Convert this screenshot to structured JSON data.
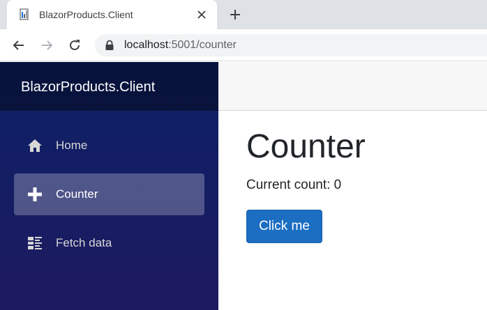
{
  "browser": {
    "tab": {
      "title": "BlazorProducts.Client"
    },
    "address": {
      "host": "localhost",
      "rest": ":5001/counter"
    }
  },
  "app": {
    "brand": "BlazorProducts.Client",
    "nav": [
      {
        "label": "Home",
        "icon": "home-icon",
        "active": false
      },
      {
        "label": "Counter",
        "icon": "plus-icon",
        "active": true
      },
      {
        "label": "Fetch data",
        "icon": "list-icon",
        "active": false
      }
    ],
    "page": {
      "title": "Counter",
      "count_text": "Current count: 0",
      "button_label": "Click me"
    }
  },
  "colors": {
    "accent": "#1b6ec2",
    "sidebar_top": "#0c2167",
    "sidebar_bottom": "#1e1a5f"
  }
}
